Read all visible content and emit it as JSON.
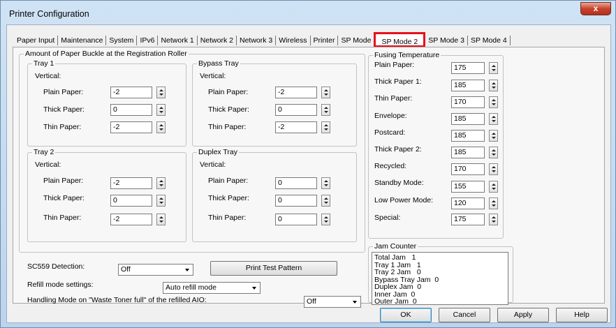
{
  "window": {
    "title": "Printer Configuration",
    "close_label": "x"
  },
  "tabs": [
    {
      "label": "Paper Input"
    },
    {
      "label": "Maintenance"
    },
    {
      "label": "System"
    },
    {
      "label": "IPv6"
    },
    {
      "label": "Network 1"
    },
    {
      "label": "Network 2"
    },
    {
      "label": "Network 3"
    },
    {
      "label": "Wireless"
    },
    {
      "label": "Printer"
    },
    {
      "label": "SP Mode"
    },
    {
      "label": "SP Mode 2",
      "active": true
    },
    {
      "label": "SP Mode 3"
    },
    {
      "label": "SP Mode 4"
    }
  ],
  "buckle": {
    "legend": "Amount of Paper Buckle at the Registration Roller",
    "vertical_label": "Vertical:",
    "plain_label": "Plain Paper:",
    "thick_label": "Thick Paper:",
    "thin_label": "Thin Paper:",
    "tray1": {
      "legend": "Tray 1",
      "plain": "-2",
      "thick": "0",
      "thin": "-2"
    },
    "bypass": {
      "legend": "Bypass Tray",
      "plain": "-2",
      "thick": "0",
      "thin": "-2"
    },
    "tray2": {
      "legend": "Tray 2",
      "plain": "-2",
      "thick": "0",
      "thin": "-2"
    },
    "duplex": {
      "legend": "Duplex Tray",
      "plain": "0",
      "thick": "0",
      "thin": "0"
    }
  },
  "fusing": {
    "legend": "Fusing Temperature",
    "rows": [
      {
        "label": "Plain Paper:",
        "value": "175"
      },
      {
        "label": "Thick Paper 1:",
        "value": "185"
      },
      {
        "label": "Thin Paper:",
        "value": "170"
      },
      {
        "label": "Envelope:",
        "value": "185"
      },
      {
        "label": "Postcard:",
        "value": "185"
      },
      {
        "label": "Thick Paper 2:",
        "value": "185"
      },
      {
        "label": "Recycled:",
        "value": "170"
      },
      {
        "label": "Standby Mode:",
        "value": "155"
      },
      {
        "label": "Low Power Mode:",
        "value": "120"
      },
      {
        "label": "Special:",
        "value": "175"
      }
    ]
  },
  "jam": {
    "legend": "Jam Counter",
    "lines": "Total Jam   1\nTray 1 Jam   1\nTray 2 Jam   0\nBypass Tray Jam  0\nDuplex Jam  0\nInner Jam  0\nOuter Jam  0"
  },
  "sc559": {
    "label": "SC559 Detection:",
    "value": "Off"
  },
  "print_test_label": "Print Test Pattern",
  "refill": {
    "label": "Refill mode settings:",
    "value": "Auto refill mode"
  },
  "waste": {
    "label": "Handling Mode on \"Waste Toner full\" of the refilled AIO:",
    "value": "Off"
  },
  "buttons": {
    "ok": "OK",
    "cancel": "Cancel",
    "apply": "Apply",
    "help": "Help"
  }
}
